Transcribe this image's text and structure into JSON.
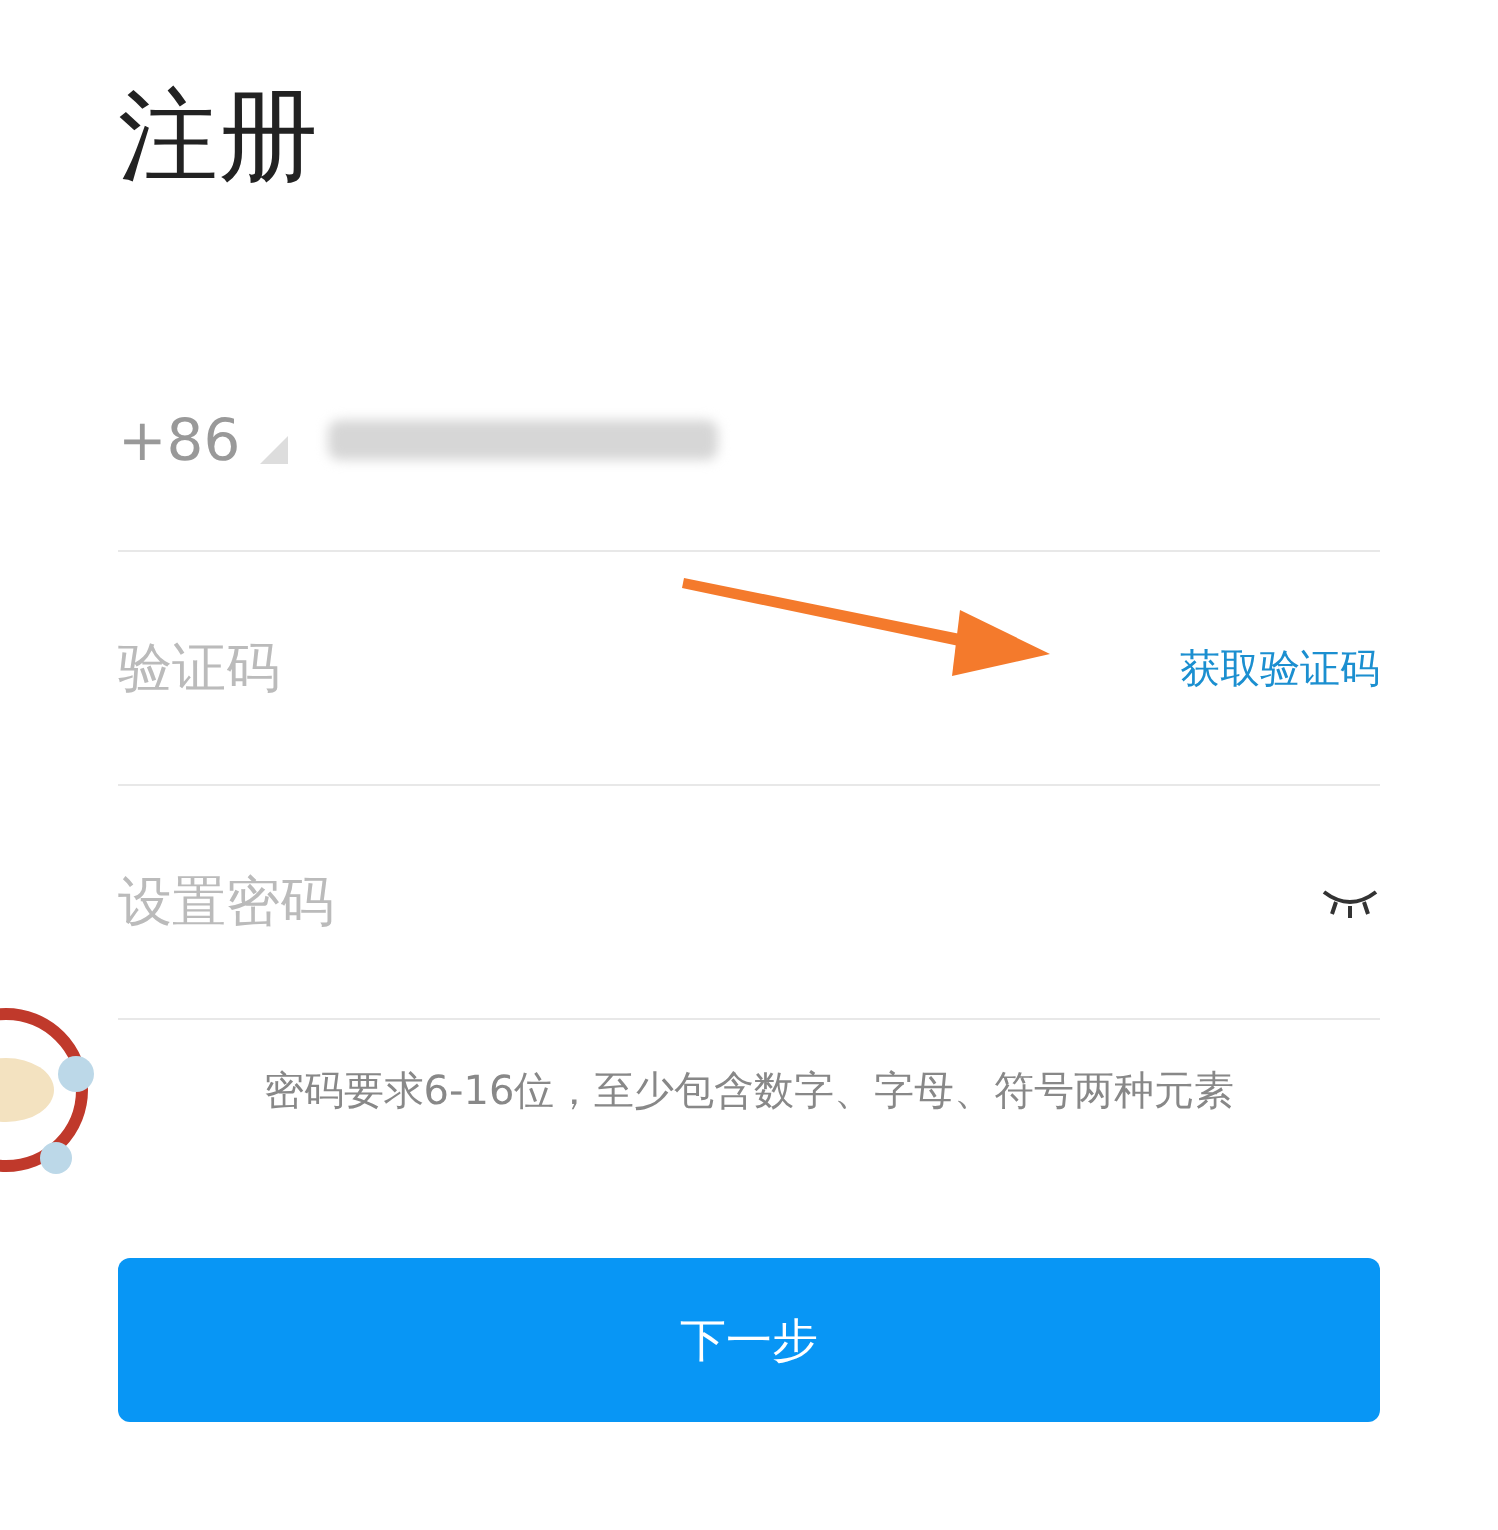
{
  "title": "注册",
  "phone": {
    "country_code": "+86"
  },
  "code_field": {
    "placeholder": "验证码",
    "action": "获取验证码"
  },
  "password_field": {
    "placeholder": "设置密码",
    "visible": false
  },
  "hint": "密码要求6-16位，至少包含数字、字母、符号两种元素",
  "submit": "下一步"
}
